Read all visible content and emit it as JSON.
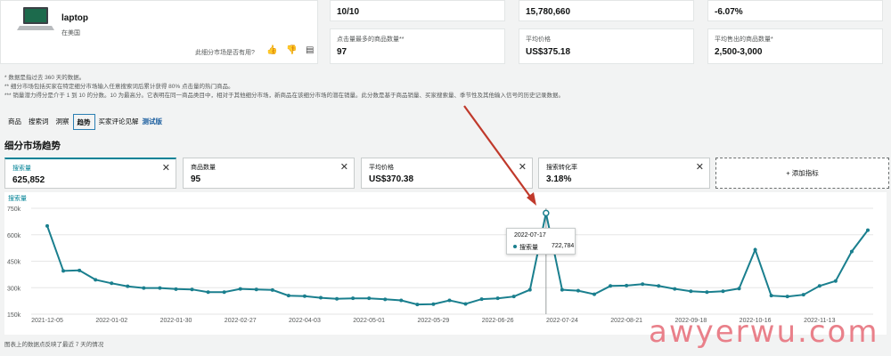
{
  "product": {
    "title": "laptop",
    "subtitle": "在美国",
    "useful_question": "此细分市场是否有用?",
    "thumb_icon": "laptop-image",
    "icons": [
      "thumbs-up-icon",
      "thumbs-down-icon",
      "comment-icon"
    ]
  },
  "top_metrics": [
    {
      "label": "",
      "value": "10/10"
    },
    {
      "label": "",
      "value": "15,780,660"
    },
    {
      "label": "",
      "value": "-6.07%"
    },
    {
      "label": "点击量最多的商品数量**",
      "value": "97"
    },
    {
      "label": "平均价格",
      "value": "US$375.18"
    },
    {
      "label": "平均售出的商品数量*",
      "value": "2,500-3,000"
    }
  ],
  "notes": [
    "* 数据是指过去 360 天的数据。",
    "** 细分市场包括买家在特定细分市场输入任意搜索词后累计获得 80% 点击量的热门商品。",
    "*** 销量潜力得分是介于 1 到 10 的分数。10 为最高分。它表明在同一商品类目中，相对于其他细分市场，新商品在该细分市场的潜在销量。此分数是基于商品销量、买家搜索量、季节性及其他输入信号的历史记录数据。"
  ],
  "tabs": [
    "商品",
    "搜索词",
    "洞察",
    "趋势",
    "买家评论见解",
    "测试版"
  ],
  "section_title": "细分市场趋势",
  "metric_cards": [
    {
      "label": "搜索量",
      "value": "625,852"
    },
    {
      "label": "商品数量",
      "value": "95"
    },
    {
      "label": "平均价格",
      "value": "US$370.38"
    },
    {
      "label": "搜索转化率",
      "value": "3.18%"
    }
  ],
  "add_metric": "+ 添加指标",
  "tooltip": {
    "date": "2022-07-17",
    "key": "搜索量",
    "value": "722,784"
  },
  "footnote": "图表上的数据点反映了最近 7 天的情况",
  "watermark": "awyerwu.com",
  "colors": {
    "line": "#1a7f8e",
    "accent": "#008296",
    "arrow": "#c0392b"
  },
  "chart_data": {
    "type": "line",
    "title": "",
    "ylabel": "搜索量",
    "xlabel": "",
    "ylim": [
      150000,
      750000
    ],
    "y_ticks": [
      "150k",
      "300k",
      "450k",
      "600k",
      "750k"
    ],
    "x_ticks": [
      "2021-12-05",
      "2022-01-02",
      "2022-01-30",
      "2022-02-27",
      "2022-04-03",
      "2022-05-01",
      "2022-05-29",
      "2022-06-26",
      "2022-07-24",
      "2022-08-21",
      "2022-09-18",
      "2022-10-16",
      "2022-11-13"
    ],
    "series": [
      {
        "name": "",
        "values": [
          650000,
          395000,
          398000,
          345000,
          325000,
          308000,
          298000,
          298000,
          292000,
          290000,
          275000,
          275000,
          293000,
          290000,
          287000,
          255000,
          252000,
          243000,
          237000,
          240000,
          240000,
          234000,
          228000,
          205000,
          207000,
          228000,
          208000,
          235000,
          240000,
          250000,
          288000,
          722784,
          288000,
          283000,
          263000,
          310000,
          312000,
          320000,
          310000,
          293000,
          280000,
          275000,
          280000,
          295000,
          515000,
          255000,
          250000,
          260000,
          310000,
          338000,
          505000,
          625852
        ]
      }
    ],
    "highlight_index": 31,
    "grid": true
  }
}
